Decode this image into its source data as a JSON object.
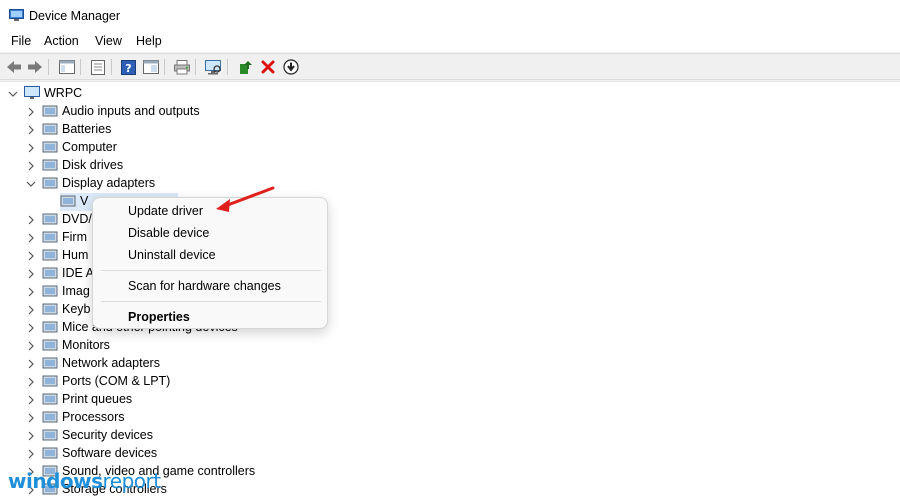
{
  "window": {
    "title": "Device Manager"
  },
  "menu": [
    "File",
    "Action",
    "View",
    "Help"
  ],
  "tree": {
    "root": "WRPC",
    "categories": [
      {
        "label": "Audio inputs and outputs",
        "icon": "speaker-icon"
      },
      {
        "label": "Batteries",
        "icon": "battery-icon"
      },
      {
        "label": "Computer",
        "icon": "computer-icon"
      },
      {
        "label": "Disk drives",
        "icon": "disk-drive-icon"
      },
      {
        "label": "Display adapters",
        "icon": "display-adapter-icon",
        "expanded": true
      },
      {
        "label": "V",
        "icon": "display-adapter-icon",
        "child": true,
        "selected": true
      },
      {
        "label": "DVD/",
        "icon": "dvd-drive-icon"
      },
      {
        "label": "Firm",
        "icon": "firmware-icon"
      },
      {
        "label": "Hum",
        "icon": "hid-icon"
      },
      {
        "label": "IDE A",
        "icon": "ide-controller-icon"
      },
      {
        "label": "Imag",
        "icon": "camera-icon"
      },
      {
        "label": "Keyb",
        "icon": "keyboard-icon"
      },
      {
        "label": "Mice and other pointing devices",
        "icon": "mouse-icon"
      },
      {
        "label": "Monitors",
        "icon": "monitor-icon"
      },
      {
        "label": "Network adapters",
        "icon": "network-adapter-icon"
      },
      {
        "label": "Ports (COM & LPT)",
        "icon": "port-icon"
      },
      {
        "label": "Print queues",
        "icon": "printer-icon"
      },
      {
        "label": "Processors",
        "icon": "processor-icon"
      },
      {
        "label": "Security devices",
        "icon": "security-device-icon"
      },
      {
        "label": "Software devices",
        "icon": "software-device-icon"
      },
      {
        "label": "Sound, video and game controllers",
        "icon": "sound-controller-icon"
      },
      {
        "label": "Storage controllers",
        "icon": "storage-controller-icon"
      }
    ]
  },
  "context_menu": {
    "update_driver": "Update driver",
    "disable_device": "Disable device",
    "uninstall_device": "Uninstall device",
    "scan": "Scan for hardware changes",
    "properties": "Properties"
  },
  "watermark": {
    "part1": "windows",
    "part2": "report"
  },
  "colors": {
    "selection": "#dbe9f8",
    "accent_arrow": "#e0201c",
    "watermark": "#1e8fd8"
  }
}
